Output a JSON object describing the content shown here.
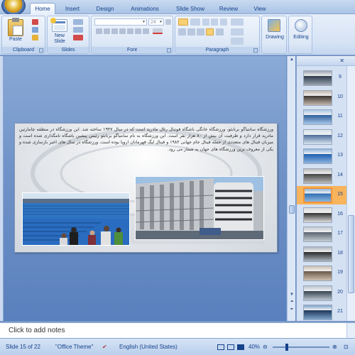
{
  "tabs": [
    "Home",
    "Insert",
    "Design",
    "Animations",
    "Slide Show",
    "Review",
    "View"
  ],
  "ribbon": {
    "groups": {
      "clipboard": "Clipboard",
      "slides": "Slides",
      "font": "Font",
      "paragraph": "Paragraph"
    },
    "paste_label": "Paste",
    "new_slide_label": "New\nSlide",
    "font_size_value": "24",
    "drawing_label": "Drawing",
    "editing_label": "Editing"
  },
  "slide": {
    "body_text": "ورزشگاه سانتیاگو برنابئو، ورزشگاه خانگی باشگاه فوتبال رئال مادرید است که در سال ۱۹۴۷ ساخته شد. این ورزشگاه در منطقه چامارتین مادرید قرار دارد و ظرفیت آن بیش از ۸۰ هزار نفر است. این ورزشگاه به نام سانتیاگو برنابئو رئیس پیشین باشگاه نامگذاری شده است و میزبان فینال های متعددی از جمله فینال جام جهانی ۱۹۸۲ و فینال لیگ قهرمانان اروپا بوده است. ورزشگاه در سال های اخیر بازسازی شده و یکی از معروف ترین ورزشگاه های جهان به شمار می رود."
  },
  "slides_pane": {
    "numbers": [
      "9",
      "10",
      "11",
      "12",
      "13",
      "14",
      "15",
      "16",
      "17",
      "18",
      "19",
      "20",
      "21"
    ],
    "selected": "15"
  },
  "notes_placeholder": "Click to add notes",
  "status": {
    "slide_counter": "Slide 15 of 22",
    "theme": "\"Office Theme\"",
    "language": "English (United States)",
    "zoom": "40%"
  }
}
